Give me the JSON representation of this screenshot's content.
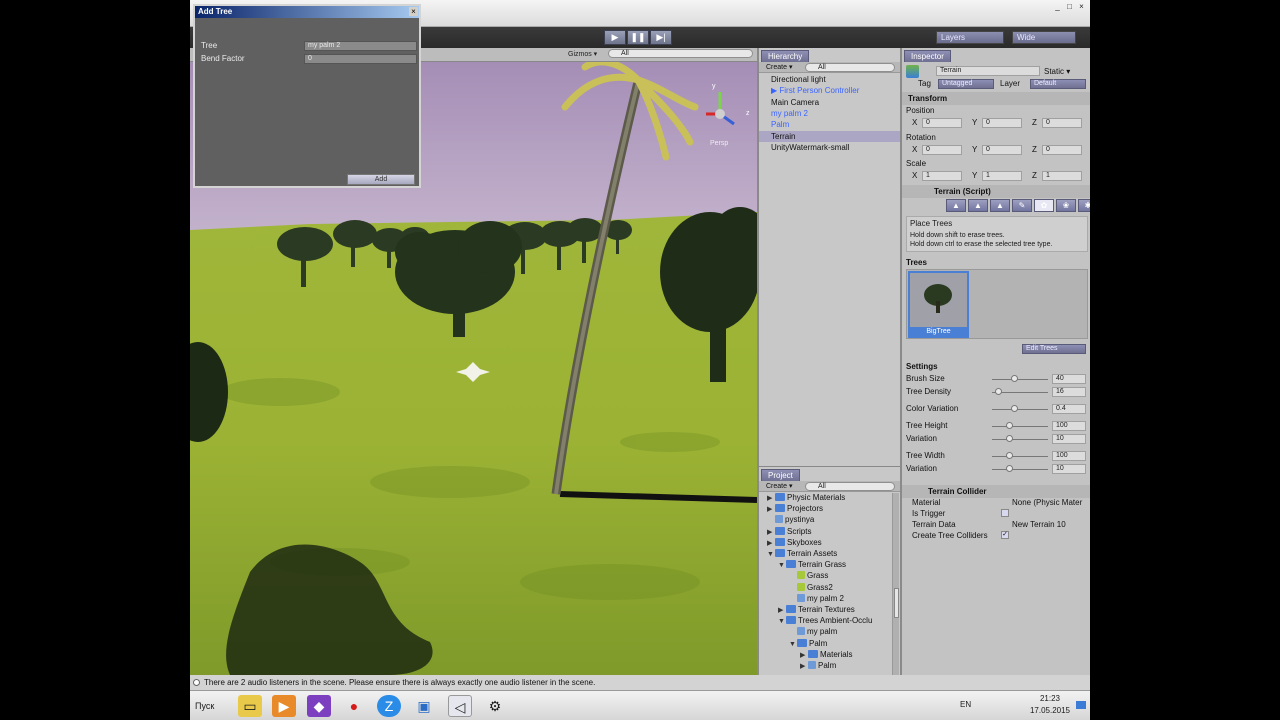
{
  "window": {
    "min": "_",
    "max": "□",
    "close": "×"
  },
  "toolbar": {
    "play": "▶",
    "pause": "❚❚",
    "step": "▶|",
    "layers": "Layers",
    "layout": "Wide"
  },
  "scene": {
    "gizmos": "Gizmos ▾",
    "search": "All",
    "persp": "Persp",
    "gizmo_axes": {
      "y": "y",
      "z": "z"
    }
  },
  "dialog": {
    "title": "Add Tree",
    "close": "×",
    "tree_label": "Tree",
    "tree_value": "my palm 2",
    "bend_label": "Bend Factor",
    "bend_value": "0",
    "add_button": "Add"
  },
  "hierarchy": {
    "tab": "Hierarchy",
    "create": "Create ▾",
    "search": "All",
    "items": [
      {
        "label": "Directional light",
        "style": "normal"
      },
      {
        "label": "▶ First Person Controller",
        "style": "blue"
      },
      {
        "label": "Main Camera",
        "style": "normal"
      },
      {
        "label": "my palm 2",
        "style": "blue"
      },
      {
        "label": "Palm",
        "style": "blue"
      },
      {
        "label": "Terrain",
        "style": "sel"
      },
      {
        "label": "UnityWatermark-small",
        "style": "normal"
      }
    ]
  },
  "project": {
    "tab": "Project",
    "create": "Create ▾",
    "search": "All",
    "items": [
      {
        "label": "Physic Materials",
        "depth": 0,
        "folder": true,
        "open": false
      },
      {
        "label": "Projectors",
        "depth": 0,
        "folder": true,
        "open": false
      },
      {
        "label": "pystinya",
        "depth": 0,
        "folder": false,
        "open": null
      },
      {
        "label": "Scripts",
        "depth": 0,
        "folder": true,
        "open": false
      },
      {
        "label": "Skyboxes",
        "depth": 0,
        "folder": true,
        "open": false
      },
      {
        "label": "Terrain Assets",
        "depth": 0,
        "folder": true,
        "open": true
      },
      {
        "label": "Terrain Grass",
        "depth": 1,
        "folder": true,
        "open": true
      },
      {
        "label": "Grass",
        "depth": 2,
        "folder": false,
        "open": null
      },
      {
        "label": "Grass2",
        "depth": 2,
        "folder": false,
        "open": null
      },
      {
        "label": "my palm 2",
        "depth": 2,
        "folder": false,
        "open": null
      },
      {
        "label": "Terrain Textures",
        "depth": 1,
        "folder": true,
        "open": false
      },
      {
        "label": "Trees Ambient-Occlu",
        "depth": 1,
        "folder": true,
        "open": true
      },
      {
        "label": "my palm",
        "depth": 2,
        "folder": false,
        "open": null
      },
      {
        "label": "Palm",
        "depth": 2,
        "folder": true,
        "open": true
      },
      {
        "label": "Materials",
        "depth": 3,
        "folder": true,
        "open": false
      },
      {
        "label": "Palm",
        "depth": 3,
        "folder": false,
        "open": false
      }
    ]
  },
  "inspector": {
    "tab": "Inspector",
    "object_name": "Terrain",
    "static": "Static ▾",
    "tag_label": "Tag",
    "tag_value": "Untagged",
    "layer_label": "Layer",
    "layer_value": "Default",
    "transform": {
      "title": "Transform",
      "position_label": "Position",
      "rotation_label": "Rotation",
      "scale_label": "Scale",
      "position": [
        "0",
        "0",
        "0"
      ],
      "rotation": [
        "0",
        "0",
        "0"
      ],
      "scale": [
        "1",
        "1",
        "1"
      ]
    },
    "terrain_script": {
      "title": "Terrain (Script)",
      "tool_icons": [
        "▲",
        "▲",
        "▲",
        "✎",
        "✿",
        "❀",
        "✱"
      ],
      "place_trees": "Place Trees",
      "hint1": "Hold down shift to erase trees.",
      "hint2": "Hold down ctrl to erase the selected tree type.",
      "trees_label": "Trees",
      "tree_name": "BigTree",
      "edit_trees": "Edit Trees",
      "settings_label": "Settings",
      "settings": [
        {
          "label": "Brush Size",
          "value": "40",
          "fraction": 0.4
        },
        {
          "label": "Tree Density",
          "value": "16",
          "fraction": 0.1
        },
        {
          "label": "Color Variation",
          "value": "0.4",
          "fraction": 0.4
        },
        {
          "label": "Tree Height",
          "value": "100",
          "fraction": 0.3
        },
        {
          "label": "Variation",
          "value": "10",
          "fraction": 0.3
        },
        {
          "label": "Tree Width",
          "value": "100",
          "fraction": 0.3
        },
        {
          "label": "Variation",
          "value": "10",
          "fraction": 0.3
        }
      ]
    },
    "collider": {
      "title": "Terrain Collider",
      "material_label": "Material",
      "material_value": "None (Physic Mater",
      "trigger_label": "Is Trigger",
      "data_label": "Terrain Data",
      "data_value": "New Terrain 10",
      "colliders_label": "Create Tree Colliders"
    }
  },
  "status": {
    "message": "There are 2 audio listeners in the scene. Please ensure there is always exactly one audio listener in the scene."
  },
  "taskbar": {
    "start": "Пуск",
    "lang": "EN",
    "time": "21:23",
    "date": "17.05.2015"
  }
}
